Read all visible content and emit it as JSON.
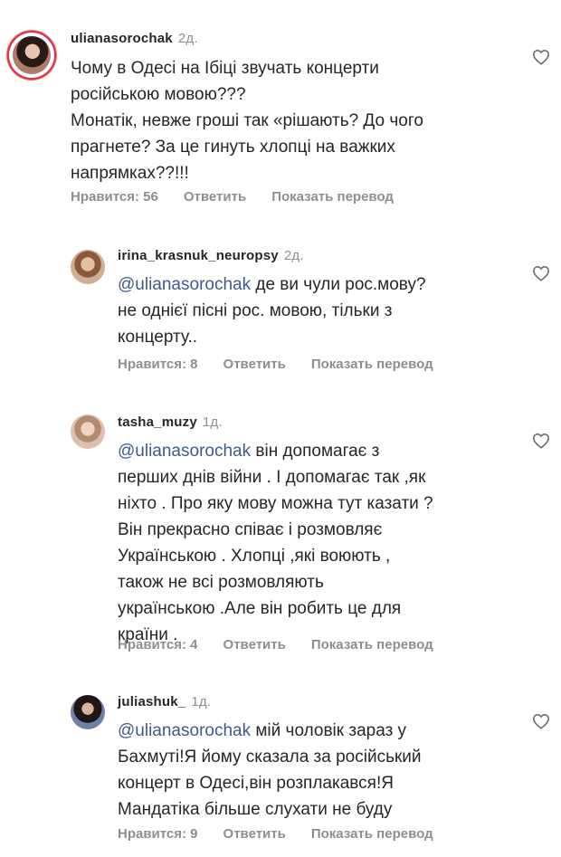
{
  "comments": [
    {
      "username": "ulianasorochak",
      "time": "2д.",
      "text": "Чому в Одесі на Ібіці звучать концерти\nросійською мовою???\nМонатік, невже гроші так «рішають? До чого\nпрагнете? За це гинуть хлопці на важких\nнапрямках??!!!",
      "likes": "Нравится: 56",
      "reply": "Ответить",
      "translate": "Показать перевод"
    },
    {
      "username": "irina_krasnuk_neuropsy",
      "time": "2д.",
      "mention": "@ulianasorochak",
      "text": " де ви чули рос.мову?\nне однієї пісні рос. мовою, тільки з\nконцерту..",
      "likes": "Нравится: 8",
      "reply": "Ответить",
      "translate": "Показать перевод"
    },
    {
      "username": "tasha_muzy",
      "time": "1д.",
      "mention": "@ulianasorochak",
      "text": " він допомагає з\nперших днів війни . І допомагає так ,як\nніхто . Про яку мову можна тут казати ?\nВін прекрасно співає і розмовляє\nУкраїнською . Хлопці ,які воюють ,\nтакож не всі розмовляють\nукраїнською .Але він робить це для\nкраїни .",
      "likes": "Нравится: 4",
      "reply": "Ответить",
      "translate": "Показать перевод"
    },
    {
      "username": "juliashuk_",
      "time": "1д.",
      "mention": "@ulianasorochak",
      "text": " мій чоловік зараз у\nБахмуті!Я йому сказала за російський\nконцерт в Одесі,він розплакався!Я\nМандатіка більше слухати не буду",
      "likes": "Нравится: 9",
      "reply": "Ответить",
      "translate": "Показать перевод"
    }
  ]
}
